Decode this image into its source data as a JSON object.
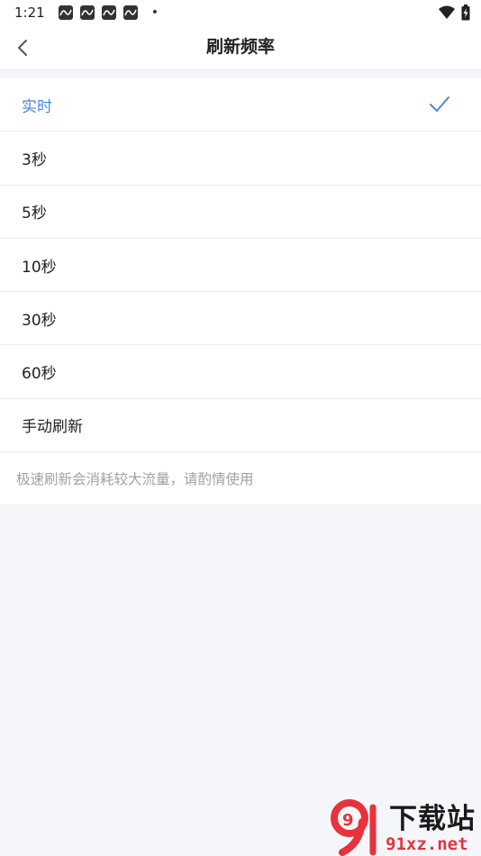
{
  "status_bar": {
    "time": "1:21",
    "notification_icons": [
      "app-notification-icon",
      "app-notification-icon",
      "app-notification-icon",
      "app-notification-icon"
    ],
    "more_dot": "•",
    "wifi_icon": "wifi-icon",
    "battery_icon": "battery-charging-icon"
  },
  "header": {
    "title": "刷新频率",
    "back_icon": "chevron-left-icon"
  },
  "options": [
    {
      "label": "实时",
      "selected": true
    },
    {
      "label": "3秒",
      "selected": false
    },
    {
      "label": "5秒",
      "selected": false
    },
    {
      "label": "10秒",
      "selected": false
    },
    {
      "label": "30秒",
      "selected": false
    },
    {
      "label": "60秒",
      "selected": false
    },
    {
      "label": "手动刷新",
      "selected": false
    }
  ],
  "hint": "极速刷新会消耗较大流量，请酌情使用",
  "colors": {
    "accent": "#4a86e8",
    "text": "#222222",
    "hint": "#9ea2ab",
    "background": "#f5f6fa"
  },
  "watermark": {
    "logo_text": "9",
    "cn_text": "下载站",
    "url_text": "91xz.net"
  }
}
